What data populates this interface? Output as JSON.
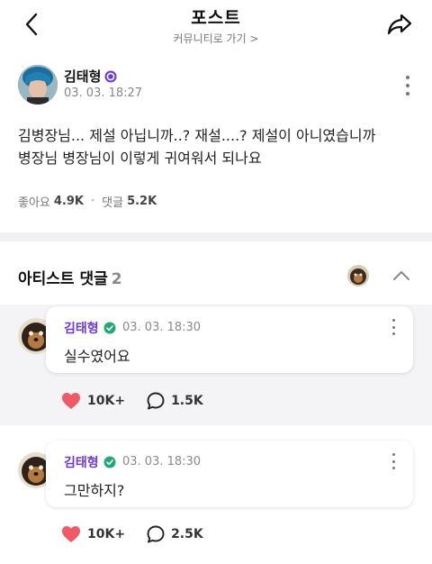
{
  "header": {
    "title": "포스트",
    "subtitle": "커뮤니티로 가기 >"
  },
  "post": {
    "author": "김태형",
    "date": "03. 03. 18:27",
    "body_line1": "김병장님... 제설 아닙니까..? 재설....? 제설이 아니였습니까",
    "body_line2": "병장님 병장님이 이렇게 귀여워서 되나요",
    "likes_label": "좋아요",
    "likes_count": "4.9K",
    "comments_label": "댓글",
    "comments_count": "5.2K",
    "separator": "·"
  },
  "artist_comments": {
    "title": "아티스트 댓글",
    "count": "2",
    "items": [
      {
        "author": "김태형",
        "date": "03. 03. 18:30",
        "text": "실수였어요",
        "likes": "10K+",
        "replies": "1.5K"
      },
      {
        "author": "김태형",
        "date": "03. 03. 18:30",
        "text": "그만하지?",
        "likes": "10K+",
        "replies": "2.5K"
      }
    ]
  },
  "colors": {
    "artist_name": "#6e3ad6",
    "like_heart": "#f05a66",
    "badge": "#6e3ad6",
    "verified": "#22a874"
  },
  "icons": [
    "back-arrow-icon",
    "share-icon",
    "verified-badge-icon",
    "more-icon",
    "chevron-up-icon",
    "heart-icon",
    "comment-icon"
  ]
}
